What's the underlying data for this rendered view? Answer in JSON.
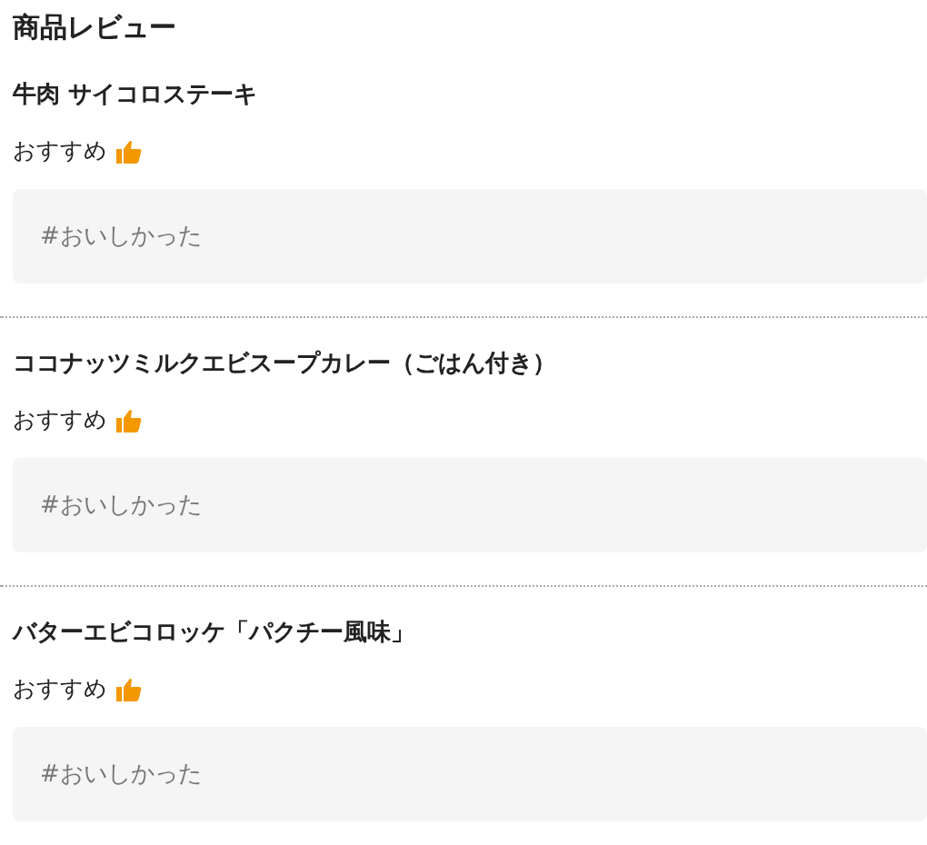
{
  "title": "商品レビュー",
  "reviews": [
    {
      "product": "牛肉 サイコロステーキ",
      "rating_label": "おすすめ",
      "recommended": true,
      "tag": "#おいしかった"
    },
    {
      "product": "ココナッツミルクエビスープカレー（ごはん付き）",
      "rating_label": "おすすめ",
      "recommended": true,
      "tag": "#おいしかった"
    },
    {
      "product": "バターエビコロッケ「パクチー風味」",
      "rating_label": "おすすめ",
      "recommended": true,
      "tag": "#おいしかった"
    }
  ]
}
